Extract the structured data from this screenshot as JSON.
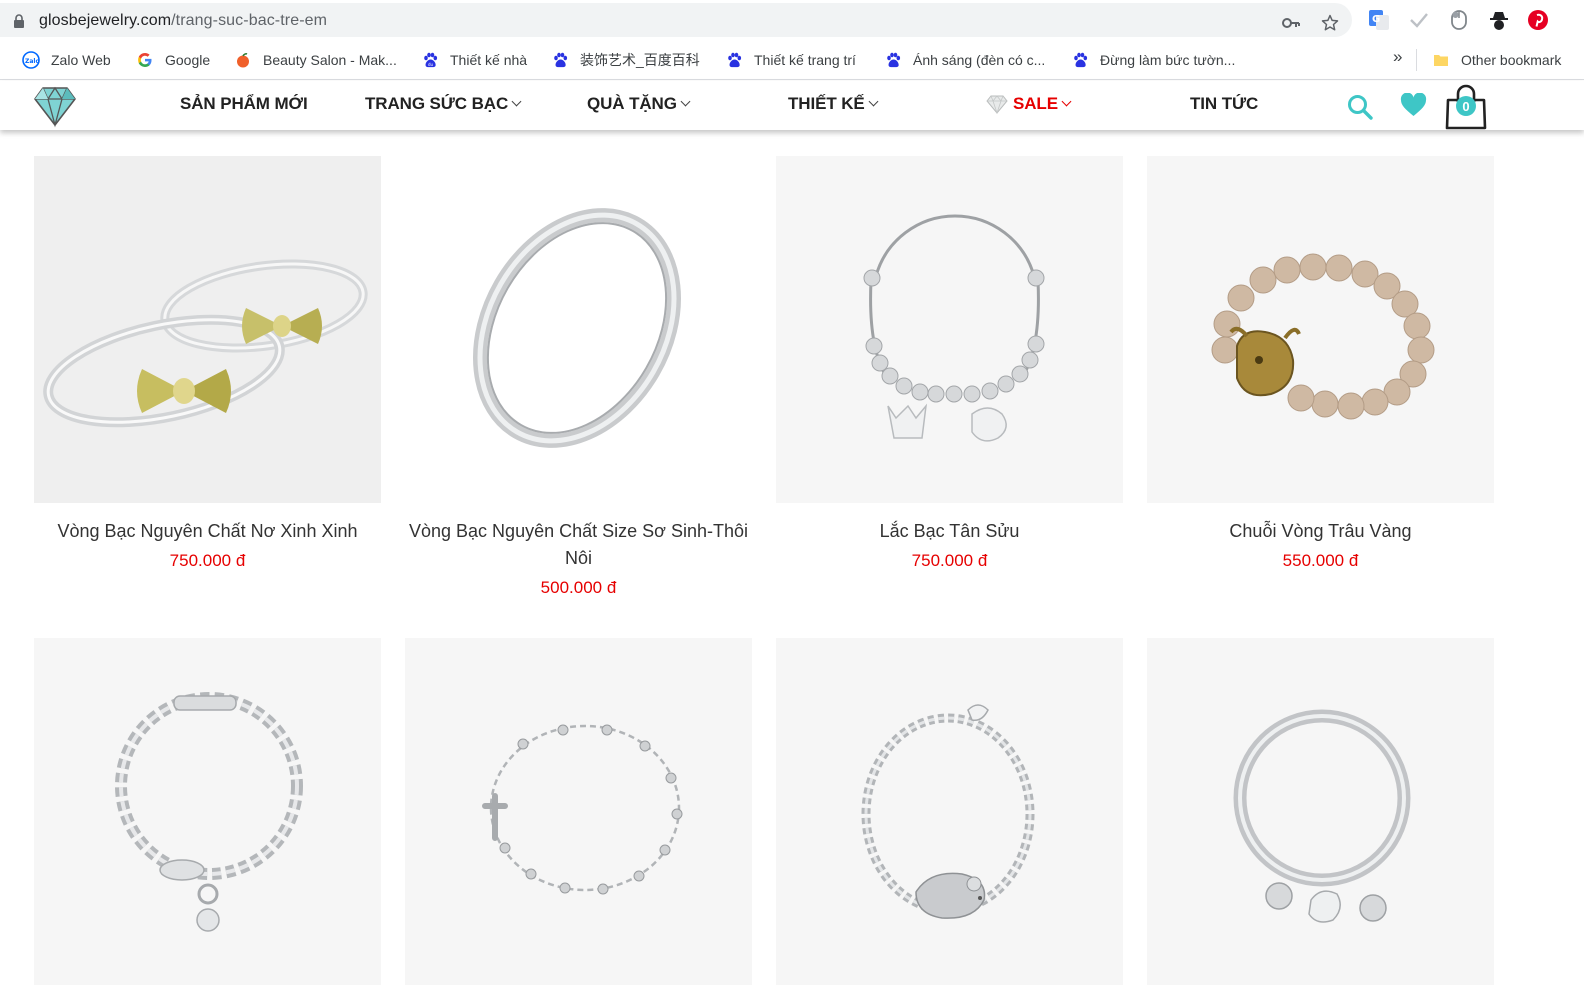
{
  "address_bar": {
    "domain": "glosbejewelry.com",
    "path": "/trang-suc-bac-tre-em"
  },
  "bookmarks": [
    {
      "label": "Zalo Web",
      "icon": "zalo-icon"
    },
    {
      "label": "Google",
      "icon": "google-icon"
    },
    {
      "label": "Beauty Salon - Mak...",
      "icon": "peach-icon"
    },
    {
      "label": "Thiết kế nhà",
      "icon": "baidu-paw-icon"
    },
    {
      "label": "装饰艺术_百度百科",
      "icon": "baidu-paw-icon"
    },
    {
      "label": "Thiết kế trang trí",
      "icon": "baidu-paw-icon"
    },
    {
      "label": "Ánh sáng (đèn có c...",
      "icon": "baidu-paw-icon"
    },
    {
      "label": "Đừng làm bức tườn...",
      "icon": "baidu-paw-icon"
    }
  ],
  "bookmarks_more": "»",
  "other_bookmarks": "Other bookmark",
  "nav": {
    "new_products": "SẢN PHẨM MỚI",
    "silver_jewelry": "TRANG SỨC BẠC",
    "gifts": "QUÀ TẶNG",
    "design": "THIẾT KẾ",
    "sale": "SALE",
    "news": "TIN TỨC"
  },
  "cart_count": "0",
  "colors": {
    "accent_teal": "#3ec6c6",
    "price_red": "#e60000"
  },
  "products": [
    {
      "name": "Vòng Bạc Nguyên Chất Nơ Xinh Xinh",
      "price": "750.000 đ"
    },
    {
      "name": "Vòng Bạc Nguyên Chất Size Sơ Sinh-Thôi Nôi",
      "price": "500.000 đ"
    },
    {
      "name": "Lắc Bạc Tân Sửu",
      "price": "750.000 đ"
    },
    {
      "name": "Chuỗi Vòng Trâu Vàng",
      "price": "550.000 đ"
    },
    {
      "name": "",
      "price": ""
    },
    {
      "name": "",
      "price": ""
    },
    {
      "name": "",
      "price": ""
    },
    {
      "name": "",
      "price": ""
    }
  ]
}
